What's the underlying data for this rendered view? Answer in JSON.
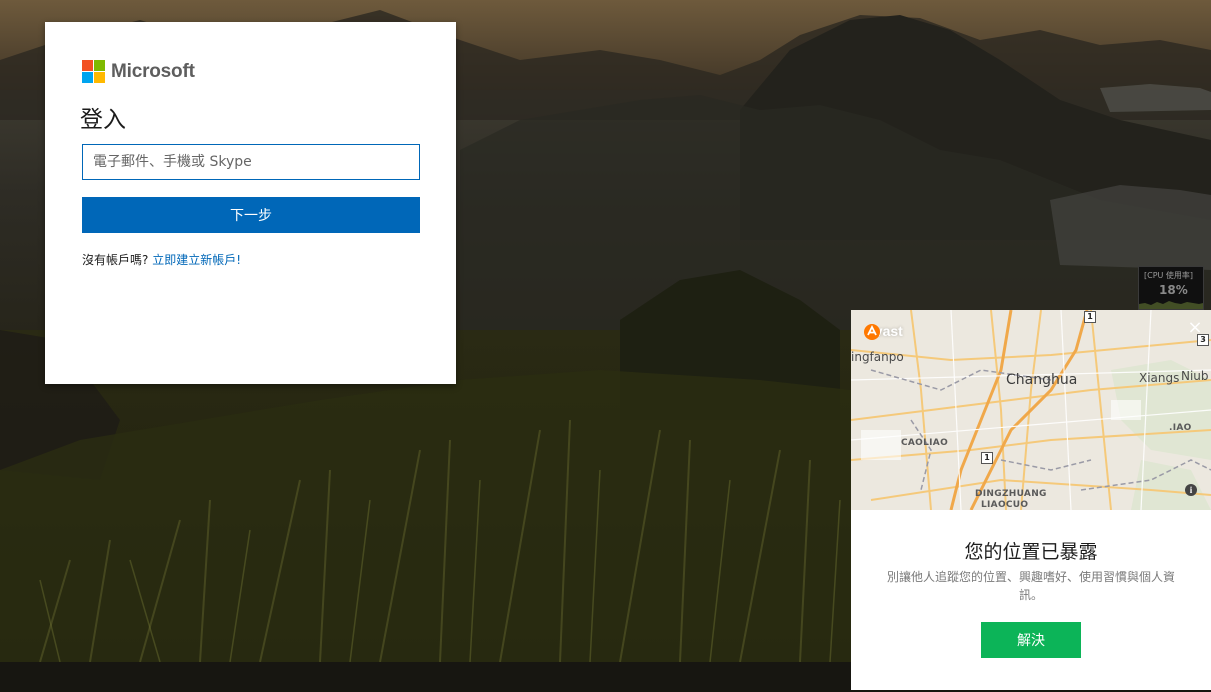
{
  "microsoft": {
    "logo_text": "Microsoft",
    "logo_colors": [
      "#f25022",
      "#7fba00",
      "#00a4ef",
      "#ffb900"
    ],
    "title": "登入",
    "email_placeholder": "電子郵件、手機或 Skype",
    "next_label": "下一步",
    "no_account_text": "沒有帳戶嗎?",
    "create_account_link": "立即建立新帳戶!",
    "accent_color": "#0067b8"
  },
  "cpu_meter": {
    "label": "[CPU 使用率]",
    "value": "18%"
  },
  "avast": {
    "brand": "avast",
    "brand_color": "#ff7800",
    "close_icon": "close-icon",
    "map_labels": {
      "place_1": "ingfanpo",
      "place_2": "Changhua",
      "place_3": "Xiangs",
      "place_4": "Niub",
      "place_5": "CAOLIAO",
      "place_6": ".IAO",
      "place_7": "DINGZHUANG",
      "place_8": "LIAOCUO",
      "road_1": "1",
      "road_2": "1",
      "road_3": "3"
    },
    "info_icon": "info-icon",
    "title": "您的位置已暴露",
    "description": "別讓他人追蹤您的位置、興趣嗜好、使用習慣與個人資訊。",
    "fix_label": "解決",
    "button_color": "#0cb458"
  }
}
